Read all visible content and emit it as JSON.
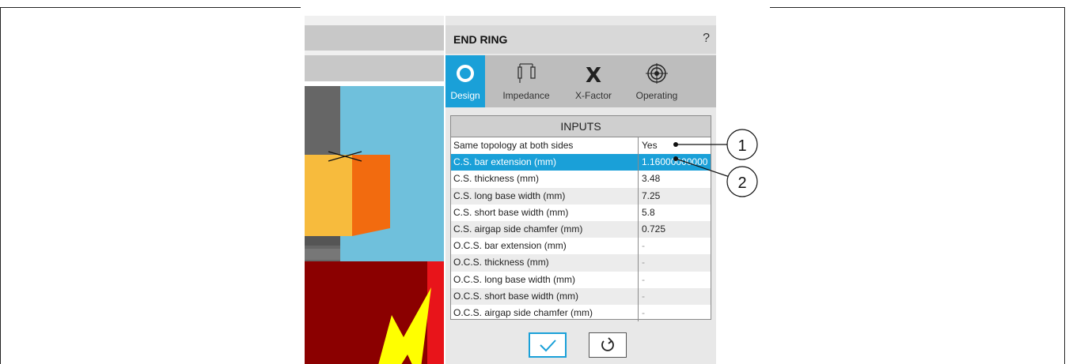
{
  "panel": {
    "title": "END RING",
    "help": "?"
  },
  "tabs": [
    {
      "label": "Design",
      "icon": "ring-icon",
      "active": true
    },
    {
      "label": "Impedance",
      "icon": "impedance-icon",
      "active": false
    },
    {
      "label": "X-Factor",
      "icon": "x-factor-icon",
      "active": false
    },
    {
      "label": "Operating",
      "icon": "target-icon",
      "active": false
    }
  ],
  "table": {
    "header": "INPUTS",
    "rows": [
      {
        "label": "Same topology at both sides",
        "value": "Yes"
      },
      {
        "label": "C.S. bar extension (mm)",
        "value": "1.16000000000"
      },
      {
        "label": "C.S. thickness (mm)",
        "value": "3.48"
      },
      {
        "label": "C.S. long base width (mm)",
        "value": "7.25"
      },
      {
        "label": "C.S. short base width (mm)",
        "value": "5.8"
      },
      {
        "label": "C.S. airgap side chamfer (mm)",
        "value": "0.725"
      },
      {
        "label": "O.C.S. bar extension (mm)",
        "value": "-"
      },
      {
        "label": "O.C.S. thickness (mm)",
        "value": "-"
      },
      {
        "label": "O.C.S. long base width (mm)",
        "value": "-"
      },
      {
        "label": "O.C.S. short base width (mm)",
        "value": "-"
      },
      {
        "label": "O.C.S. airgap side chamfer (mm)",
        "value": "-"
      }
    ]
  },
  "callouts": [
    "1",
    "2"
  ],
  "colors": {
    "accent": "#1aa0d8",
    "steel_blue": "#6fc0dc",
    "gold": "#f7bb3d",
    "orange": "#f26b0f",
    "dark_red": "#8b0000",
    "red": "#e8141a",
    "yellow": "#ffff00"
  }
}
